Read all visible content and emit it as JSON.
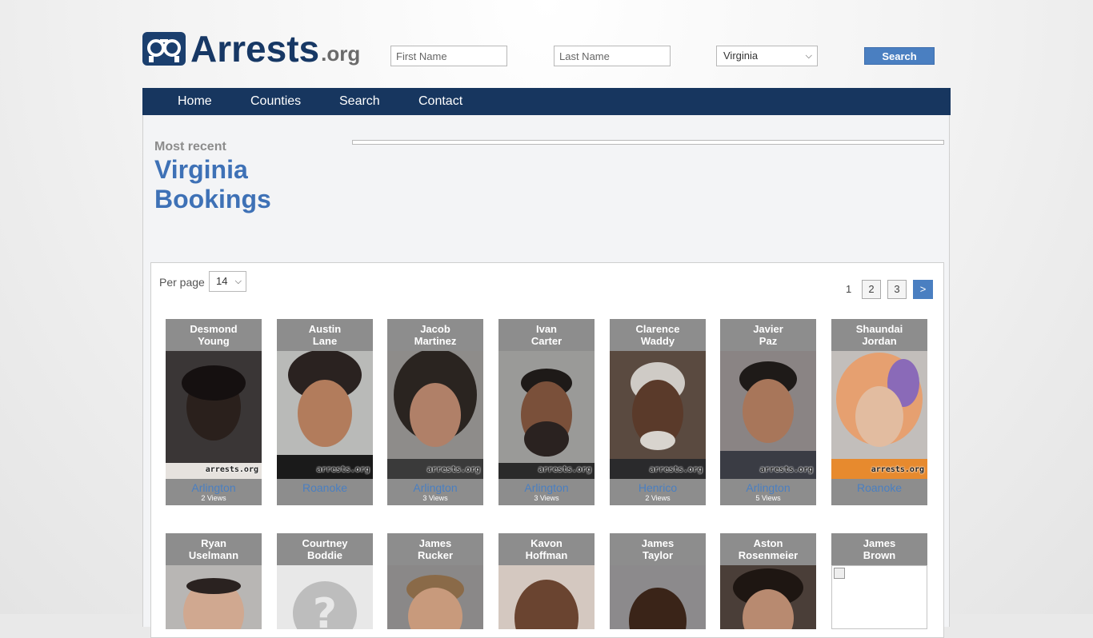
{
  "logo": {
    "name": "Arrests",
    "suffix": ".org"
  },
  "search": {
    "first_name_placeholder": "First Name",
    "last_name_placeholder": "Last Name",
    "state_value": "Virginia",
    "button_label": "Search"
  },
  "nav": {
    "items": [
      "Home",
      "Counties",
      "Search",
      "Contact"
    ]
  },
  "page": {
    "subtitle": "Most recent",
    "title_line1": "Virginia",
    "title_line2": "Bookings"
  },
  "grid": {
    "per_page_label": "Per page",
    "per_page_value": "14",
    "pagination": {
      "current": "1",
      "pages": [
        "2",
        "3"
      ],
      "next": ">"
    },
    "watermark": "arrests.org",
    "rows": [
      [
        {
          "first": "Desmond",
          "last": "Young",
          "county": "Arlington",
          "views": "2 Views"
        },
        {
          "first": "Austin",
          "last": "Lane",
          "county": "Roanoke",
          "views": ""
        },
        {
          "first": "Jacob",
          "last": "Martinez",
          "county": "Arlington",
          "views": "3 Views"
        },
        {
          "first": "Ivan",
          "last": "Carter",
          "county": "Arlington",
          "views": "3 Views"
        },
        {
          "first": "Clarence",
          "last": "Waddy",
          "county": "Henrico",
          "views": "2 Views"
        },
        {
          "first": "Javier",
          "last": "Paz",
          "county": "Arlington",
          "views": "5 Views"
        },
        {
          "first": "Shaundai",
          "last": "Jordan",
          "county": "Roanoke",
          "views": ""
        }
      ],
      [
        {
          "first": "Ryan",
          "last": "Uselmann"
        },
        {
          "first": "Courtney",
          "last": "Boddie"
        },
        {
          "first": "James",
          "last": "Rucker"
        },
        {
          "first": "Kavon",
          "last": "Hoffman"
        },
        {
          "first": "James",
          "last": "Taylor"
        },
        {
          "first": "Aston",
          "last": "Rosenmeier"
        },
        {
          "first": "James",
          "last": "Brown"
        }
      ]
    ]
  },
  "colors": {
    "nav_bg": "#17365f",
    "accent": "#4a7fc1",
    "title_blue": "#3e71b6",
    "card_bg": "#8d8d8d"
  }
}
